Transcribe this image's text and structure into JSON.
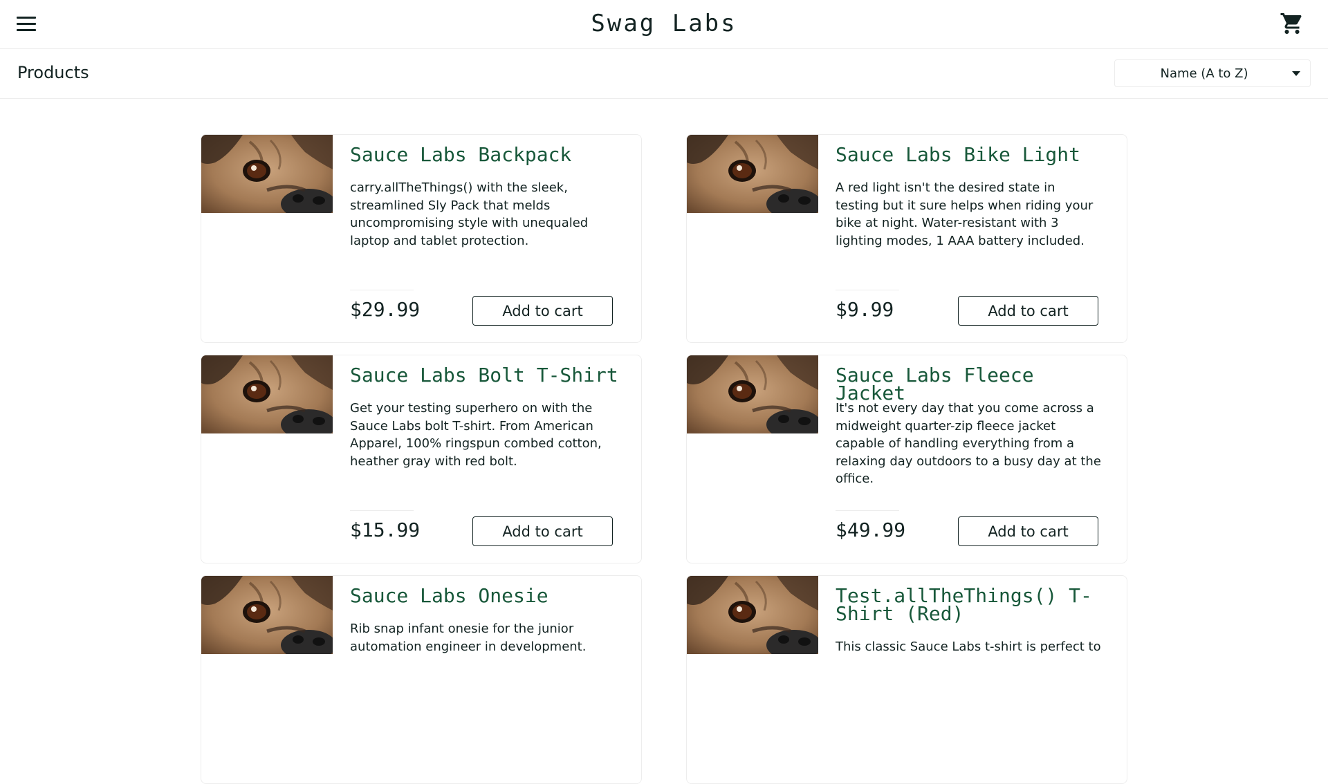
{
  "header": {
    "app_title": "Swag Labs",
    "menu_icon": "hamburger-menu-icon",
    "cart_icon": "shopping-cart-icon"
  },
  "subheader": {
    "title": "Products",
    "sort": {
      "selected": "Name (A to Z)",
      "icon": "caret-down-icon"
    }
  },
  "products": [
    {
      "name": "Sauce Labs Backpack",
      "description": "carry.allTheThings() with the sleek, streamlined Sly Pack that melds uncompromising style with unequaled laptop and tablet protection.",
      "price": "$29.99",
      "button": "Add to cart"
    },
    {
      "name": "Sauce Labs Bike Light",
      "description": "A red light isn't the desired state in testing but it sure helps when riding your bike at night. Water-resistant with 3 lighting modes, 1 AAA battery included.",
      "price": "$9.99",
      "button": "Add to cart"
    },
    {
      "name": "Sauce Labs Bolt T-Shirt",
      "description": "Get your testing superhero on with the Sauce Labs bolt T-shirt. From American Apparel, 100% ringspun combed cotton, heather gray with red bolt.",
      "price": "$15.99",
      "button": "Add to cart"
    },
    {
      "name": "Sauce Labs Fleece Jacket",
      "description": "It's not every day that you come across a midweight quarter-zip fleece jacket capable of handling everything from a relaxing day outdoors to a busy day at the office.",
      "price": "$49.99",
      "button": "Add to cart"
    },
    {
      "name": "Sauce Labs Onesie",
      "description": "Rib snap infant onesie for the junior automation engineer in development.",
      "price": "",
      "button": ""
    },
    {
      "name": "Test.allTheThings() T-Shirt (Red)",
      "description": "This classic Sauce Labs t-shirt is perfect to",
      "price": "",
      "button": ""
    }
  ],
  "colors": {
    "text": "#132322",
    "product_name": "#18583a",
    "border": "#ededed"
  }
}
